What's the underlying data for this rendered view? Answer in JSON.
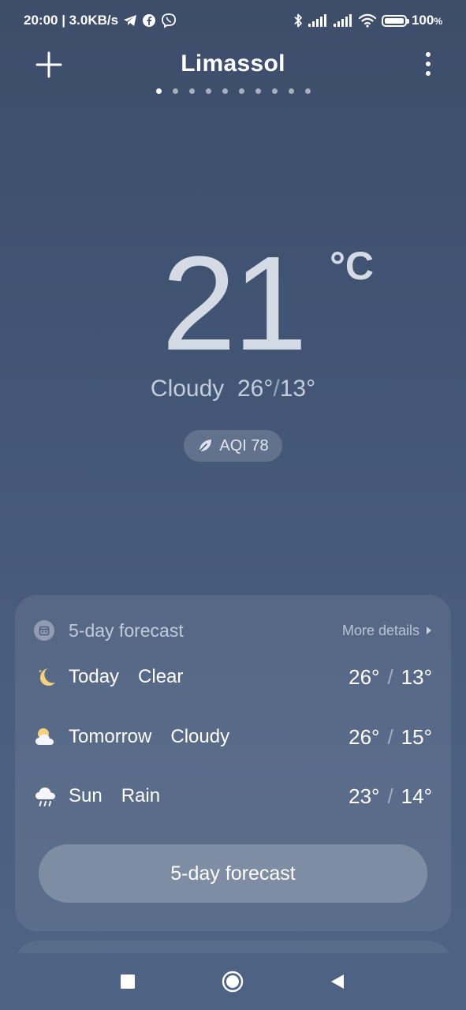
{
  "status_bar": {
    "time_speed": "20:00 | 3.0KB/s",
    "battery_pct": "100",
    "battery_suffix": "%",
    "icons": [
      "telegram-icon",
      "facebook-icon",
      "viber-icon",
      "bluetooth-icon",
      "signal-icon",
      "signal-icon",
      "wifi-icon",
      "battery-icon"
    ]
  },
  "header": {
    "city": "Limassol",
    "add_icon": "plus-icon",
    "menu_icon": "more-vertical-icon",
    "page_count": 10,
    "active_page": 0
  },
  "current": {
    "temperature": "21",
    "unit": "°C",
    "condition": "Cloudy",
    "high": "26°",
    "separator": "/",
    "low": "13°",
    "aqi_label": "AQI 78",
    "aqi_icon": "leaf-icon"
  },
  "forecast": {
    "title": "5-day forecast",
    "more_label": "More details",
    "button_label": "5-day forecast",
    "days": [
      {
        "day": "Today",
        "condition": "Clear",
        "high": "26°",
        "low": "13°",
        "icon": "moon-icon"
      },
      {
        "day": "Tomorrow",
        "condition": "Cloudy",
        "high": "26°",
        "low": "15°",
        "icon": "partly-cloudy-icon"
      },
      {
        "day": "Sun",
        "condition": "Rain",
        "high": "23°",
        "low": "14°",
        "icon": "rain-icon"
      }
    ],
    "slash": "/"
  },
  "nav": {
    "icons": [
      "recents-square-icon",
      "home-circle-icon",
      "back-triangle-icon"
    ]
  },
  "colors": {
    "bg_top": "#3d4d6a",
    "bg_bottom": "#4f6485",
    "moon": "#f5d27a"
  }
}
